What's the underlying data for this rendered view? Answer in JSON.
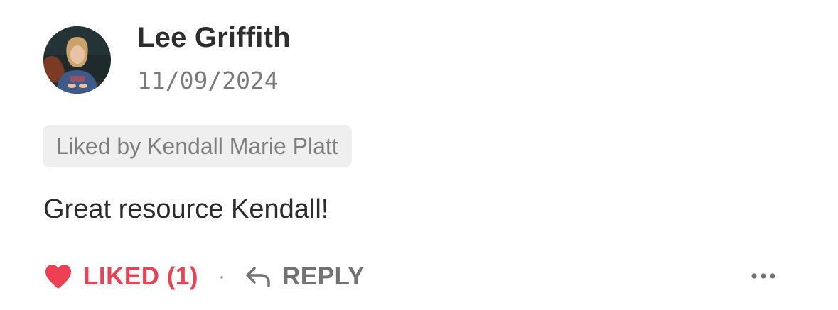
{
  "comment": {
    "author": {
      "name": "Lee Griffith",
      "avatar": "profile-photo"
    },
    "date": "11/09/2024",
    "liked_by": "Liked by Kendall Marie Platt",
    "body": "Great resource Kendall!"
  },
  "actions": {
    "like_label": "LIKED (1)",
    "like_count": 1,
    "separator": "·",
    "reply_label": "REPLY",
    "more_icon": "more-horizontal-icon"
  },
  "colors": {
    "accent_liked": "#ee4053",
    "muted_text": "#727272",
    "badge_background": "#efefef"
  }
}
